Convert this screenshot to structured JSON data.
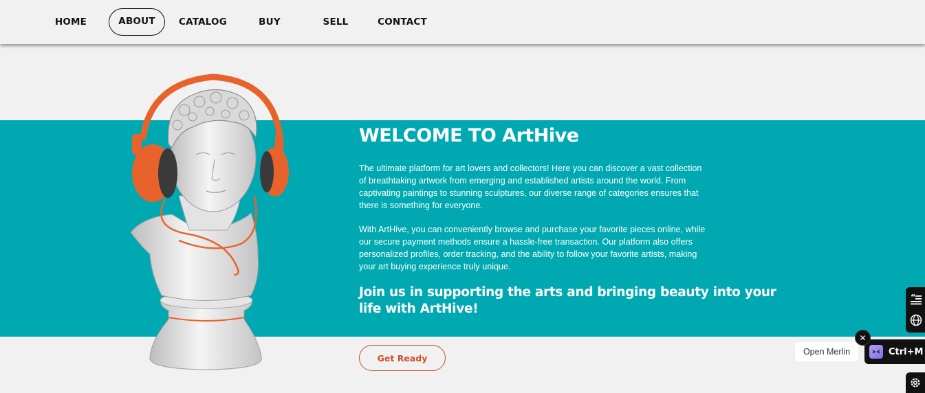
{
  "nav": {
    "items": [
      {
        "label": "HOME"
      },
      {
        "label": "ABOUT",
        "active": true
      },
      {
        "label": "CATALOG"
      },
      {
        "label": "BUY"
      },
      {
        "label": "SELL"
      },
      {
        "label": "CONTACT"
      }
    ]
  },
  "hero": {
    "title": "WELCOME TO ArtHive",
    "paragraph1": "The ultimate platform for art lovers and collectors! Here you can discover a vast collection of breathtaking artwork from emerging and established artists around the world. From captivating paintings to stunning sculptures, our diverse range of categories ensures that there is something for everyone.",
    "paragraph2": "With ArtHive, you can conveniently browse and purchase your favorite pieces online, while our secure payment methods ensure a hassle-free transaction. Our platform also offers personalized profiles, order tracking, and the ability to follow your favorite artists, making your art buying experience truly unique.",
    "cta_text": "Join us in supporting the arts and bringing beauty into your life with ArtHive!",
    "button_label": "Get Ready"
  },
  "merlin": {
    "open_label": "Open Merlin",
    "shortcut": "Ctrl+M",
    "close_glyph": "✕"
  },
  "colors": {
    "teal": "#00a9b1",
    "accent": "#c8512b",
    "background": "#f1f1f1",
    "headphones": "#e8632b"
  },
  "icons": [
    "quote-icon",
    "globe-icon",
    "gear-icon",
    "merlin-logo-icon",
    "close-icon",
    "statue-bust-image"
  ]
}
